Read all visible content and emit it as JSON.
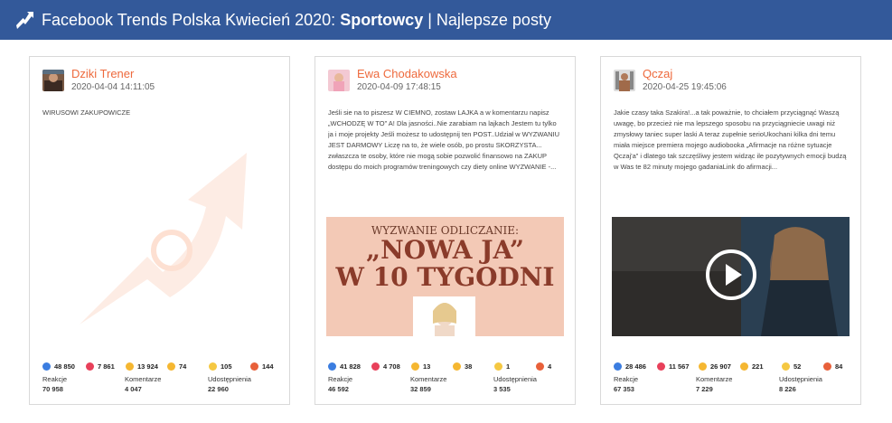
{
  "header": {
    "title_prefix": "Facebook Trends Polska Kwiecień 2020: ",
    "title_bold": "Sportowcy",
    "title_suffix": " | Najlepsze posty"
  },
  "labels": {
    "reactions": "Reakcje",
    "comments": "Komentarze",
    "shares": "Udostępnienia"
  },
  "colors": {
    "header_bg": "#33599a",
    "author": "#ee6a3d"
  },
  "posts": [
    {
      "author": "Dziki Trener",
      "date": "2020-04-04 14:11:05",
      "text": "WIRUSOWI ZAKUPOWICZE",
      "media": "trend-arrow-placeholder",
      "reactions": {
        "like": "48 850",
        "love": "7 861",
        "haha": "13 924",
        "wow": "74",
        "sad": "105",
        "angry": "144"
      },
      "stats": {
        "reactions": "70 958",
        "comments": "4 047",
        "shares": "22 960"
      }
    },
    {
      "author": "Ewa Chodakowska",
      "date": "2020-04-09 17:48:15",
      "text": "Jeśli sie na to piszesz W CIEMNO, zostaw LAJKA a w komentarzu napisz „WCHODZĘ W TO” A! Dla jasności..Nie zarabiam na lajkach Jestem tu tylko ja i moje projekty Jeśli możesz to udostępnij ten POST..Udział w WYZWANIU JEST DARMOWY Liczę na to, że wiele osób, po prostu SKORZYSTA... zwłaszcza te osoby, które nie mogą sobie pozwolić finansowo na ZAKUP dostępu do moich programów treningowych czy diety online WYZWANIE -...",
      "media": "challenge-poster",
      "poster": {
        "line1": "WYZWANIE ODLICZANIE:",
        "line2": "„NOWA JA”",
        "line3": "W 10 TYGODNI"
      },
      "reactions": {
        "like": "41 828",
        "love": "4 708",
        "haha": "13",
        "wow": "38",
        "sad": "1",
        "angry": "4"
      },
      "stats": {
        "reactions": "46 592",
        "comments": "32 859",
        "shares": "3 535"
      }
    },
    {
      "author": "Qczaj",
      "date": "2020-04-25 19:45:06",
      "text": "Jakie czasy taka Szakira!...a tak poważnie, to chciałem przyciągnąć Waszą uwagę, bo przecież nie ma lepszego sposobu na przyciągniecie uwagi niż zmysłowy taniec super laski A teraz zupełnie serioUkochani kilka dni temu miała miejsce premiera mojego audiobooka „Afirmacje na różne sytuacje Qczaj'a” i dlatego tak szczęśliwy jestem widząc ile pozytywnych emocji budzą w Was te 82 minuty mojego gadaniaLink do afirmacji...",
      "media": "video-thumbnail",
      "reactions": {
        "like": "28 486",
        "love": "11 567",
        "haha": "26 907",
        "wow": "221",
        "sad": "52",
        "angry": "84"
      },
      "stats": {
        "reactions": "67 353",
        "comments": "7 229",
        "shares": "8 226"
      }
    }
  ]
}
